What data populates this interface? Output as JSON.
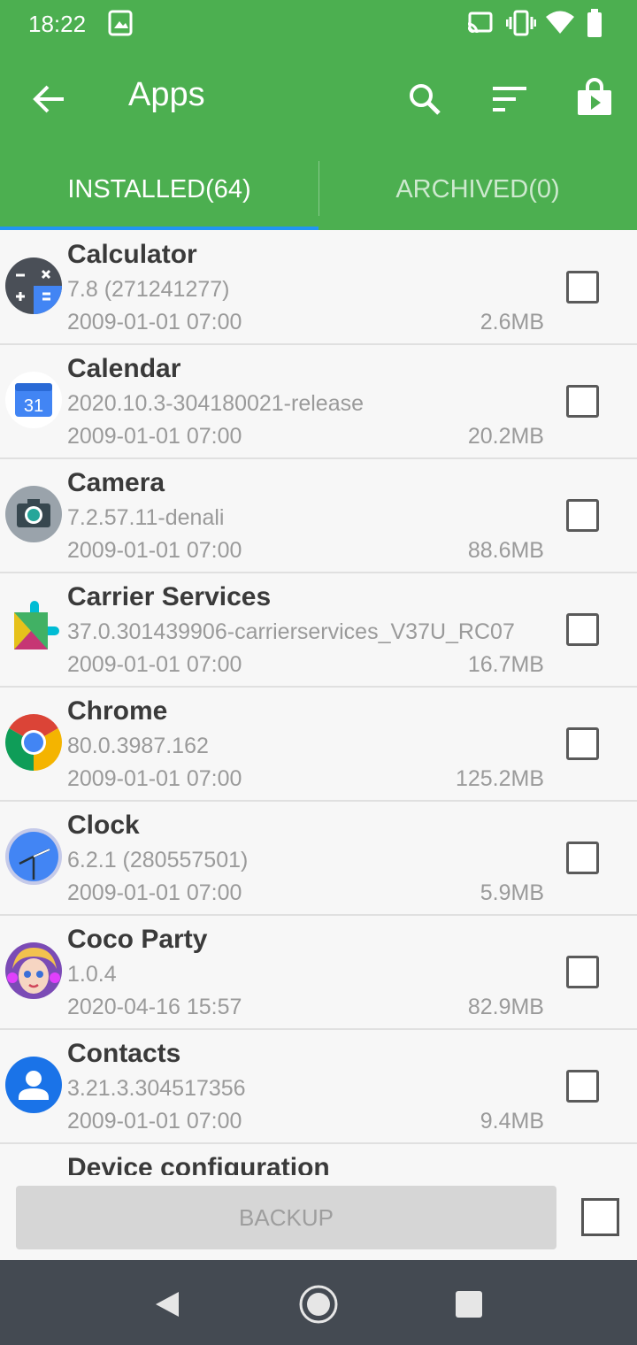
{
  "status_bar": {
    "time": "18:22",
    "icons": [
      "screenshot-icon",
      "cast-icon",
      "vibrate-icon",
      "wifi-icon",
      "battery-icon"
    ]
  },
  "app_bar": {
    "title": "Apps",
    "actions": [
      "search-icon",
      "sort-icon",
      "play-store-icon"
    ]
  },
  "tabs": [
    {
      "label": "INSTALLED(64)",
      "selected": true
    },
    {
      "label": "ARCHIVED(0)",
      "selected": false
    }
  ],
  "apps": [
    {
      "name": "Calculator",
      "version": "7.8 (271241277)",
      "date": "2009-01-01 07:00",
      "size": "2.6MB",
      "icon": "calculator-icon",
      "checked": false
    },
    {
      "name": "Calendar",
      "version": "2020.10.3-304180021-release",
      "date": "2009-01-01 07:00",
      "size": "20.2MB",
      "icon": "calendar-icon",
      "icon_text": "31",
      "checked": false
    },
    {
      "name": "Camera",
      "version": "7.2.57.11-denali",
      "date": "2009-01-01 07:00",
      "size": "88.6MB",
      "icon": "camera-icon",
      "checked": false
    },
    {
      "name": "Carrier Services",
      "version": "37.0.301439906-carrierservices_V37U_RC07",
      "date": "2009-01-01 07:00",
      "size": "16.7MB",
      "icon": "carrier-services-icon",
      "checked": false
    },
    {
      "name": "Chrome",
      "version": "80.0.3987.162",
      "date": "2009-01-01 07:00",
      "size": "125.2MB",
      "icon": "chrome-icon",
      "checked": false
    },
    {
      "name": "Clock",
      "version": "6.2.1 (280557501)",
      "date": "2009-01-01 07:00",
      "size": "5.9MB",
      "icon": "clock-icon",
      "checked": false
    },
    {
      "name": "Coco Party",
      "version": "1.0.4",
      "date": "2020-04-16 15:57",
      "size": "82.9MB",
      "icon": "coco-party-icon",
      "checked": false
    },
    {
      "name": "Contacts",
      "version": "3.21.3.304517356",
      "date": "2009-01-01 07:00",
      "size": "9.4MB",
      "icon": "contacts-icon",
      "checked": false
    },
    {
      "name": "Device configuration",
      "version": "",
      "date": "",
      "size": "",
      "icon": "device-configuration-icon",
      "checked": false
    }
  ],
  "bottom": {
    "backup_label": "BACKUP",
    "select_all_checked": false
  },
  "nav_bar": {
    "buttons": [
      "back-nav-icon",
      "home-nav-icon",
      "recents-nav-icon"
    ]
  },
  "colors": {
    "primary": "#4caf50",
    "tab_indicator": "#2196f3",
    "nav_bar": "#444a52"
  }
}
